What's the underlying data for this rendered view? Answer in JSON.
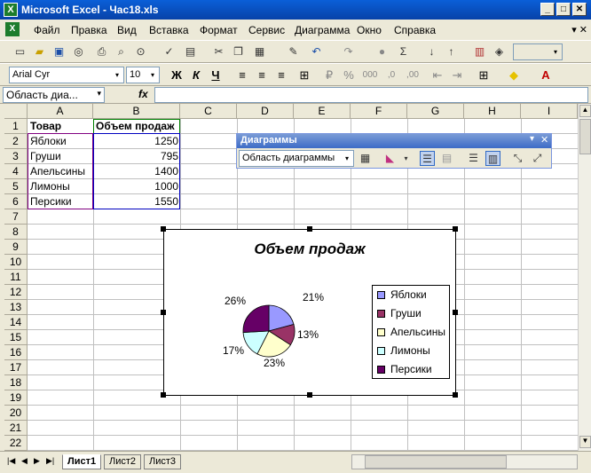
{
  "window": {
    "title": "Microsoft Excel - Час18.xls",
    "app_icon": "X"
  },
  "menu": [
    "Файл",
    "Правка",
    "Вид",
    "Вставка",
    "Формат",
    "Сервис",
    "Диаграмма",
    "Окно",
    "Справка"
  ],
  "format_bar": {
    "font": "Arial Cyr",
    "size": "10",
    "bold": "Ж",
    "italic": "К",
    "underline": "Ч"
  },
  "formula_bar": {
    "name_box": "Область диа...",
    "fx": "fx"
  },
  "columns": [
    "A",
    "B",
    "C",
    "D",
    "E",
    "F",
    "G",
    "H",
    "I"
  ],
  "rows": [
    "1",
    "2",
    "3",
    "4",
    "5",
    "6",
    "7",
    "8",
    "9",
    "10",
    "11",
    "12",
    "13",
    "14",
    "15",
    "16",
    "17",
    "18",
    "19",
    "20",
    "21",
    "22"
  ],
  "table": {
    "header": [
      "Товар",
      "Объем продаж"
    ],
    "rows": [
      {
        "name": "Яблоки",
        "value": "1250"
      },
      {
        "name": "Груши",
        "value": "795"
      },
      {
        "name": "Апельсины",
        "value": "1400"
      },
      {
        "name": "Лимоны",
        "value": "1000"
      },
      {
        "name": "Персики",
        "value": "1550"
      }
    ]
  },
  "chart_toolbar": {
    "title": "Диаграммы",
    "combo": "Область диаграммы"
  },
  "sheets": [
    "Лист1",
    "Лист2",
    "Лист3"
  ],
  "chart_data": {
    "type": "pie",
    "title": "Объем продаж",
    "categories": [
      "Яблоки",
      "Груши",
      "Апельсины",
      "Лимоны",
      "Персики"
    ],
    "values": [
      1250,
      795,
      1400,
      1000,
      1550
    ],
    "labels": [
      "21%",
      "13%",
      "23%",
      "17%",
      "26%"
    ],
    "colors": [
      "#9999ff",
      "#993366",
      "#ffffcc",
      "#ccffff",
      "#660066"
    ],
    "legend": "right"
  }
}
